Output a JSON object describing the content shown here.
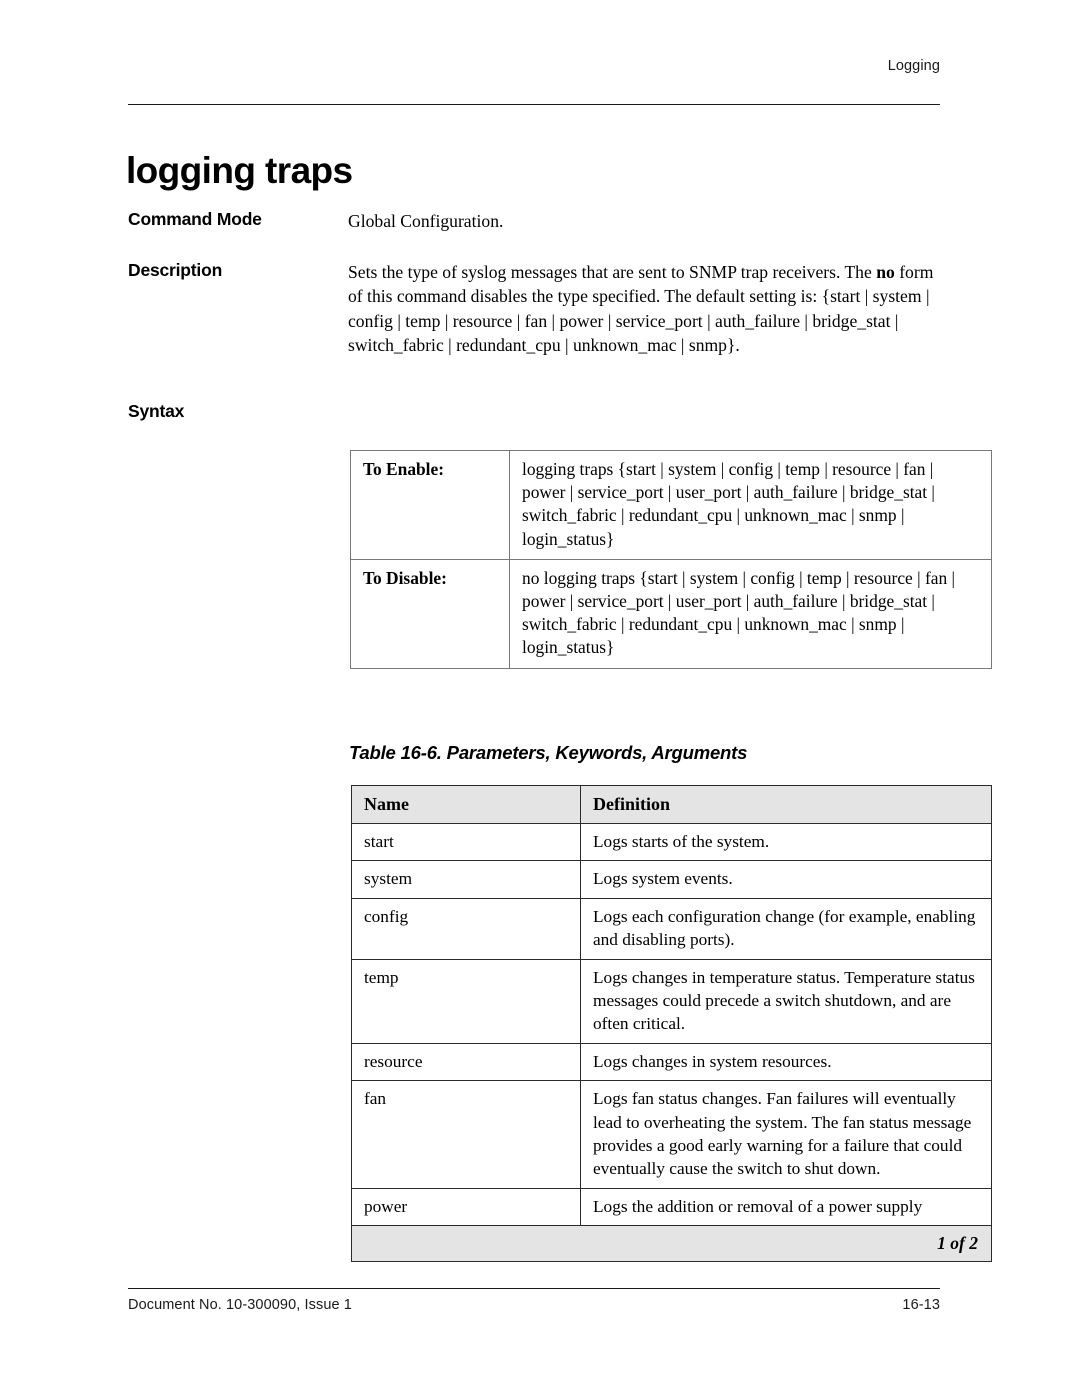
{
  "header": {
    "running_head": "Logging"
  },
  "title": "logging traps",
  "fields": {
    "command_mode": {
      "label": "Command Mode",
      "value": "Global Configuration."
    },
    "description": {
      "label": "Description",
      "text_before_bold": "Sets the type of syslog messages that are sent to SNMP trap receivers. The ",
      "bold_word": "no",
      "text_after_bold": " form of this command disables the type specified. The default setting is: {start | system | config | temp | resource | fan | power | service_port | auth_failure | bridge_stat | switch_fabric | redundant_cpu | unknown_mac | snmp}."
    },
    "syntax": {
      "label": "Syntax"
    }
  },
  "syntax_table": {
    "rows": [
      {
        "label": "To Enable:",
        "command": "logging traps {start | system | config | temp | resource | fan | power | service_port | user_port | auth_failure | bridge_stat | switch_fabric | redundant_cpu | unknown_mac | snmp | login_status}"
      },
      {
        "label": "To Disable:",
        "command": "no logging traps {start | system | config | temp | resource | fan | power | service_port | user_port | auth_failure | bridge_stat | switch_fabric | redundant_cpu | unknown_mac | snmp | login_status}"
      }
    ]
  },
  "param_table": {
    "caption": "Table 16-6.  Parameters, Keywords, Arguments",
    "columns": [
      "Name",
      "Definition"
    ],
    "rows": [
      {
        "name": "start",
        "definition": "Logs starts of the system."
      },
      {
        "name": "system",
        "definition": "Logs system events."
      },
      {
        "name": "config",
        "definition": "Logs each configuration change (for example, enabling and disabling ports)."
      },
      {
        "name": "temp",
        "definition": "Logs changes in temperature status. Temperature status messages could precede a switch shutdown, and are often critical."
      },
      {
        "name": "resource",
        "definition": "Logs changes in system resources."
      },
      {
        "name": "fan",
        "definition": "Logs fan status changes. Fan failures will eventually lead to overheating the system. The fan status message provides a good early warning for a failure that could eventually cause the switch to shut down."
      },
      {
        "name": "power",
        "definition": "Logs the addition or removal of a power supply"
      }
    ],
    "continuation": "1 of 2"
  },
  "footer": {
    "document_no": "Document No. 10-300090, Issue 1",
    "page_no": "16-13"
  }
}
